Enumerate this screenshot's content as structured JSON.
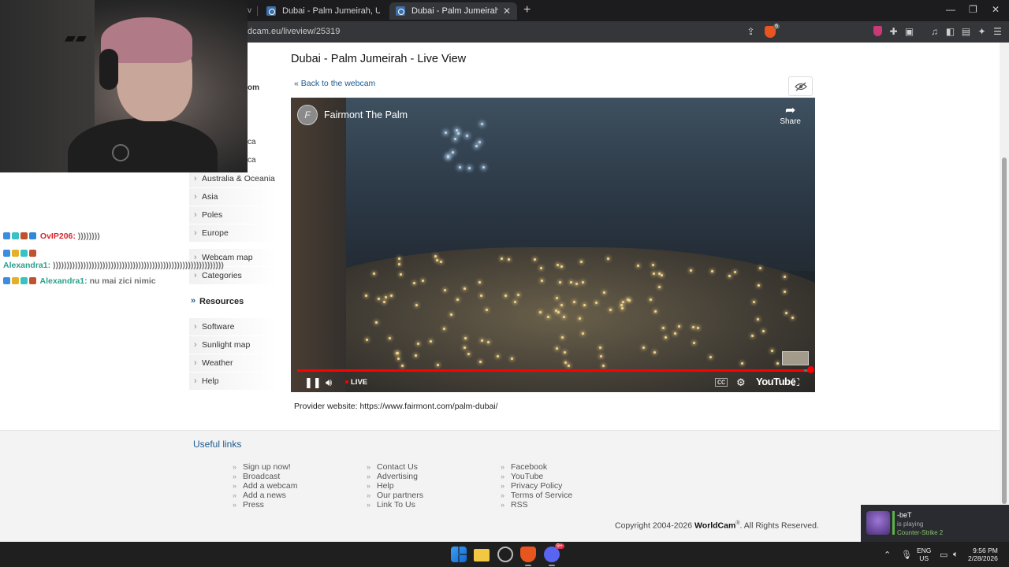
{
  "browser": {
    "tabs": [
      {
        "label": "Dubai - Palm Jumeirah, United Arab"
      },
      {
        "label": "Dubai - Palm Jumeirah, United A"
      }
    ],
    "tab_prefix": "v",
    "url": "dcam.eu/liveview/25319"
  },
  "sidebar": {
    "partial_labels": [
      "om",
      "ca",
      "ca"
    ],
    "items_top": [
      "Australia & Oceania",
      "Asia",
      "Poles",
      "Europe"
    ],
    "items_mid": [
      "Webcam map",
      "Categories"
    ],
    "resources_heading": "Resources",
    "items_bottom": [
      "Software",
      "Sunlight map",
      "Weather",
      "Help"
    ]
  },
  "chat": [
    {
      "user": "OvIP206:",
      "message": "))))))))"
    },
    {
      "user": "Alexandra1:",
      "message": "))))))))))))))))))))))))))))))))))))))))))))))))))))))))))))))"
    },
    {
      "user": "Alexandra1:",
      "message": "nu mai zici nimic"
    }
  ],
  "main": {
    "title": "Dubai - Palm Jumeirah - Live View",
    "back_link": "« Back to the webcam",
    "provider_label": "Provider website:",
    "provider_url": "https://www.fairmont.com/palm-dubai/"
  },
  "player": {
    "channel_name": "Fairmont The Palm",
    "share_label": "Share",
    "live_label": "LIVE",
    "youtube_label": "YouTube",
    "progress_fraction": 0.99
  },
  "footer": {
    "useful_links_title": "Useful links",
    "col1": [
      "Sign up now!",
      "Broadcast",
      "Add a webcam",
      "Add a news",
      "Press"
    ],
    "col2": [
      "Contact Us",
      "Advertising",
      "Help",
      "Our partners",
      "Link To Us"
    ],
    "col3": [
      "Facebook",
      "YouTube",
      "Privacy Policy",
      "Terms of Service",
      "RSS"
    ],
    "copyright_prefix": "Copyright 2004-2026",
    "copyright_brand": "WorldCam",
    "copyright_suffix": ". All Rights Reserved."
  },
  "notification": {
    "user": "-beT",
    "status": "is playing",
    "game": "Counter-Strike 2"
  },
  "taskbar": {
    "lang_line1": "ENG",
    "lang_line2": "US",
    "time": "9:56 PM",
    "date": "2/28/2026"
  },
  "colors": {
    "link": "#1b5b91",
    "chat_user1": "#d8262f",
    "chat_user2": "#2aa08a",
    "live_red": "#ff0000"
  }
}
